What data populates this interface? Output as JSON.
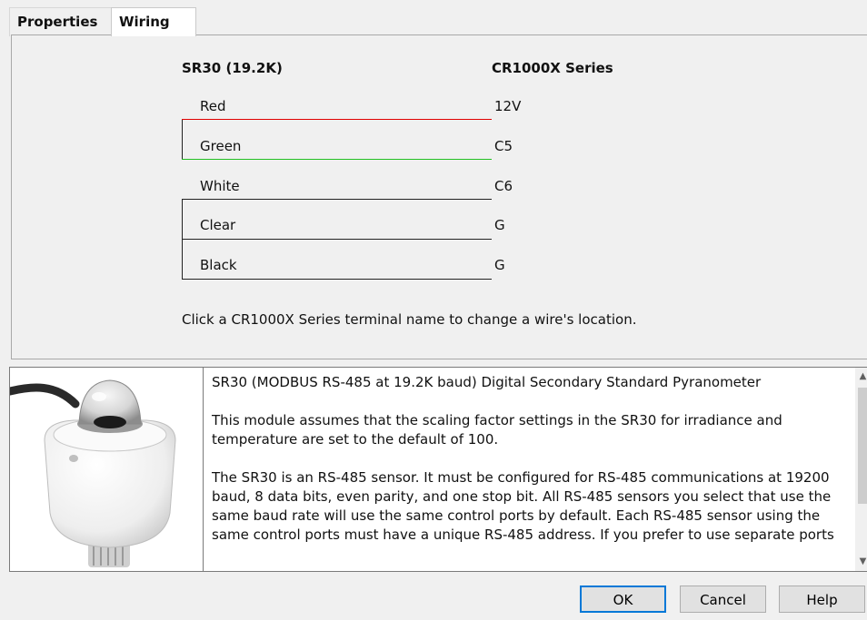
{
  "tabs": [
    {
      "label": "Properties"
    },
    {
      "label": "Wiring"
    }
  ],
  "wiring": {
    "sensor_header": "SR30 (19.2K)",
    "logger_header": "CR1000X Series",
    "wires": [
      {
        "label": "Red",
        "port": "12V",
        "color": "#e00000"
      },
      {
        "label": "Green",
        "port": "C5",
        "color": "#22c022"
      },
      {
        "label": "White",
        "port": "C6",
        "color": "#222222"
      },
      {
        "label": "Clear",
        "port": "G",
        "color": "#222222"
      },
      {
        "label": "Black",
        "port": "G",
        "color": "#222222"
      }
    ],
    "hint": "Click a CR1000X Series terminal name to change a wire's location."
  },
  "description": {
    "paragraphs": [
      "SR30 (MODBUS RS-485 at 19.2K baud) Digital Secondary Standard Pyranometer",
      "This module assumes that the scaling factor settings in the SR30 for irradiance and temperature are set to the default of 100.",
      "The SR30 is an RS-485 sensor. It must be configured for RS-485 communications at 19200 baud, 8 data bits, even parity, and one stop bit. All RS-485 sensors you select that use the same baud rate will use the same control ports by default. Each RS-485 sensor using the same control ports must have a unique RS-485 address. If you prefer to use separate ports"
    ]
  },
  "buttons": {
    "ok": "OK",
    "cancel": "Cancel",
    "help": "Help"
  }
}
